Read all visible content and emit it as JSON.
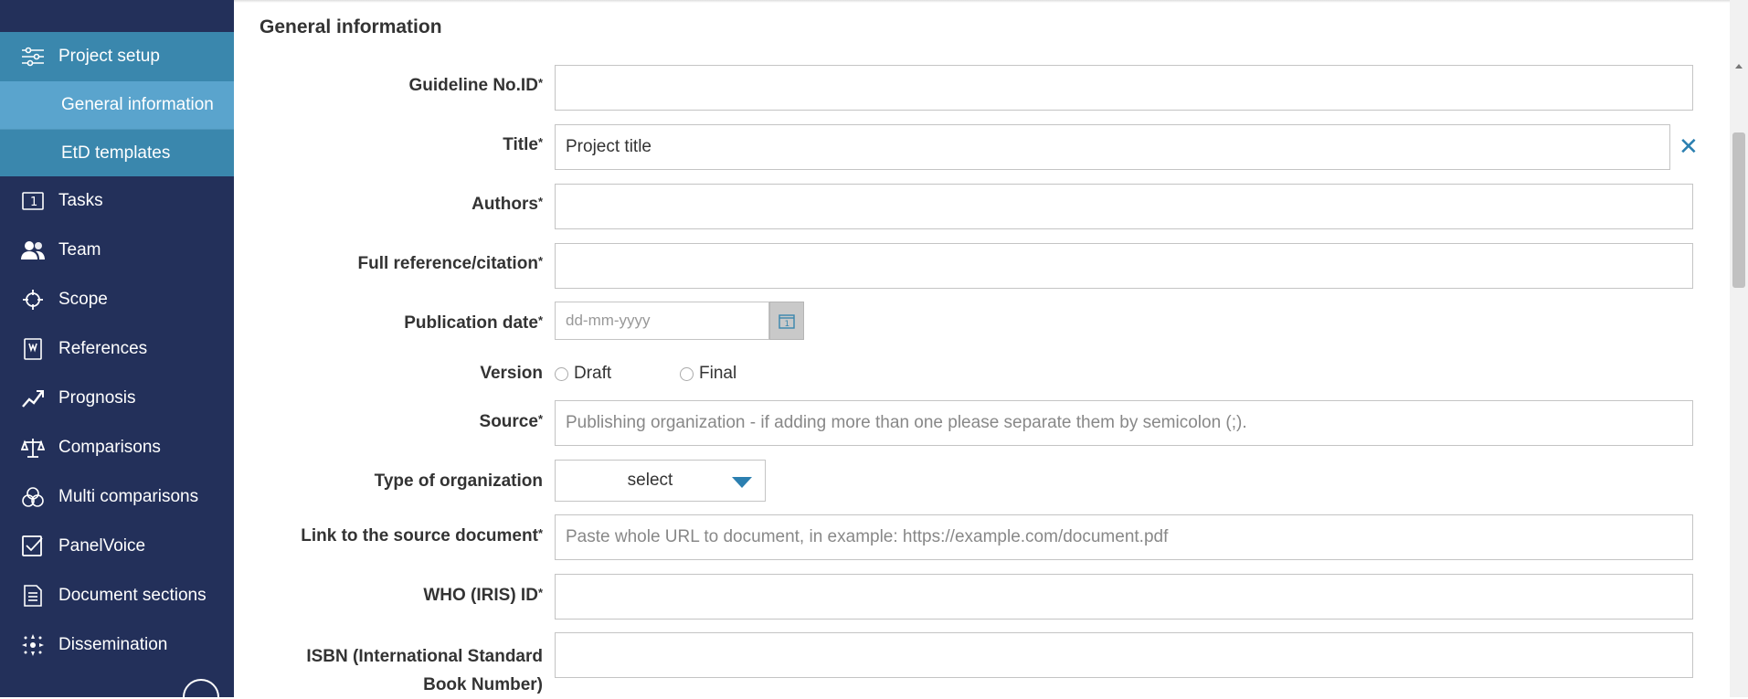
{
  "sidebar": {
    "project_setup": "Project setup",
    "sub_items": [
      "General information",
      "EtD templates"
    ],
    "items": [
      {
        "label": "Tasks",
        "icon": "tasks-icon"
      },
      {
        "label": "Team",
        "icon": "team-icon"
      },
      {
        "label": "Scope",
        "icon": "scope-icon"
      },
      {
        "label": "References",
        "icon": "references-icon"
      },
      {
        "label": "Prognosis",
        "icon": "prognosis-icon"
      },
      {
        "label": "Comparisons",
        "icon": "comparisons-icon"
      },
      {
        "label": "Multi comparisons",
        "icon": "multi-comparisons-icon"
      },
      {
        "label": "PanelVoice",
        "icon": "panelvoice-icon"
      },
      {
        "label": "Document sections",
        "icon": "document-sections-icon"
      },
      {
        "label": "Dissemination",
        "icon": "dissemination-icon"
      }
    ]
  },
  "main": {
    "section_title": "General information",
    "form": {
      "guideline_label": "Guideline No.ID",
      "title_label": "Title",
      "title_value": "Project title",
      "authors_label": "Authors",
      "citation_label": "Full reference/citation",
      "pubdate_label": "Publication date",
      "pubdate_placeholder": "dd-mm-yyyy",
      "version_label": "Version",
      "version_options": [
        "Draft",
        "Final"
      ],
      "source_label": "Source",
      "source_placeholder": "Publishing organization - if adding more than one please separate them by semicolon (;).",
      "org_type_label": "Type of organization",
      "org_type_value": "select",
      "link_label": "Link to the source document",
      "link_placeholder": "Paste whole URL to document, in example: https://example.com/document.pdf",
      "who_label": "WHO (IRIS) ID",
      "isbn_label_1": "ISBN (International Standard",
      "isbn_label_2": "Book Number)",
      "required_mark": "*"
    }
  },
  "colors": {
    "sidebar_bg": "#23305a",
    "active_parent": "#3a87ad",
    "active_sub": "#5aa4cd",
    "accent": "#2b7fb0"
  }
}
